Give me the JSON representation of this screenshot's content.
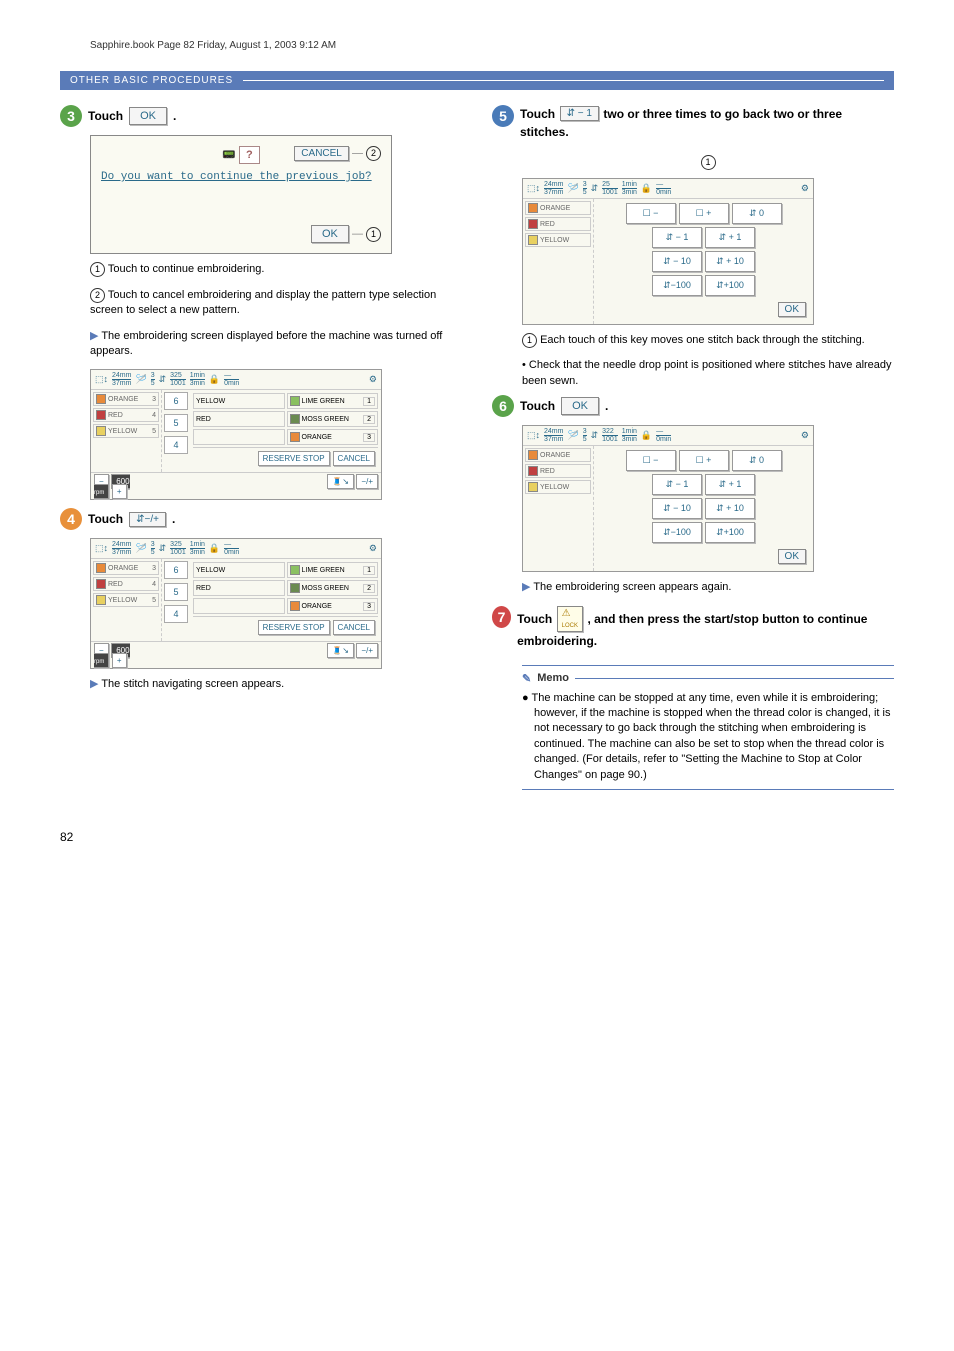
{
  "header_line": "Sapphire.book  Page 82  Friday, August 1, 2003  9:12 AM",
  "section_title": "OTHER BASIC PROCEDURES",
  "page_number": "82",
  "ok_label": "OK",
  "cancel_label": "CANCEL",
  "reserve_stop_label": "RESERVE STOP",
  "lock_label": "LOCK",
  "dialog": {
    "message": "Do you want to continue the previous job?",
    "question_icon": "?"
  },
  "dimensions": {
    "w": "24mm",
    "h": "37mm"
  },
  "header_stats": {
    "needle_frac_top": "3",
    "needle_frac_bot": "5",
    "stitch_total": "325",
    "stitch_total_bot": "1001",
    "time_top": "1min",
    "time_bot": "3min",
    "remain": "0min"
  },
  "header_stats_alt": {
    "stitch_total": "322",
    "stitch_total_bot": "1001",
    "time_top": "1min",
    "time_bot": "3min",
    "remain": "0min",
    "needle_top_alt": "25",
    "needle_bot_alt": "1001"
  },
  "thread_colors": {
    "c1": "ORANGE",
    "c2": "RED",
    "c3": "YELLOW"
  },
  "right_colors": {
    "r1": "LIME GREEN",
    "r2": "MOSS GREEN",
    "r3": "ORANGE",
    "y1": "YELLOW",
    "y2": "RED"
  },
  "mid_nums": {
    "n1": "6",
    "n2": "5",
    "n3": "4"
  },
  "thread_idx": {
    "i1": "3",
    "i2": "4",
    "i3": "5"
  },
  "right_idx": {
    "i1": "1",
    "i2": "2",
    "i3": "3"
  },
  "nav_buttons": {
    "page_minus": "−",
    "page_plus": "+",
    "b0": "0",
    "bm1": "− 1",
    "bp1": "+ 1",
    "bm10": "− 10",
    "bp10": "+ 10",
    "bm100": "−100",
    "bp100": "+100",
    "sheet_minus": "☐ −",
    "sheet_plus": "☐ +",
    "rpm_label": "600",
    "rpm_unit": "rpm",
    "nav_toggle": "−/+"
  },
  "steps": {
    "s3": "Touch",
    "s3_end": ".",
    "s4": "Touch",
    "s4_end": ".",
    "s5": "Touch",
    "s5_mid": "two or three times to go back two or three stitches.",
    "s6": "Touch",
    "s6_end": ".",
    "s7": "Touch",
    "s7_mid": ", and then press the start/stop button to continue embroidering."
  },
  "notes": {
    "n1": "Touch to continue embroidering.",
    "n2": "Touch to cancel embroidering and display the pattern type selection screen to select a new pattern.",
    "arrow1": "The embroidering screen displayed before the machine was turned off appears.",
    "arrow2": "The stitch navigating screen appears.",
    "n5_1": "Each touch of this key moves one stitch back through the stitching.",
    "n5_bullet": "Check that the needle drop point is positioned where stitches have already been sewn.",
    "arrow3": "The embroidering screen appears again."
  },
  "memo": {
    "title": "Memo",
    "body": "The machine can be stopped at any time, even while it is embroidering; however, if the machine is stopped when the thread color is changed, it is not necessary to go back through the stitching when embroidering is continued. The machine can also be set to stop when the thread color is changed. (For details, refer to \"Setting the Machine to Stop at Color Changes\" on page 90.)"
  },
  "callouts": {
    "c1": "1",
    "c2": "2"
  }
}
